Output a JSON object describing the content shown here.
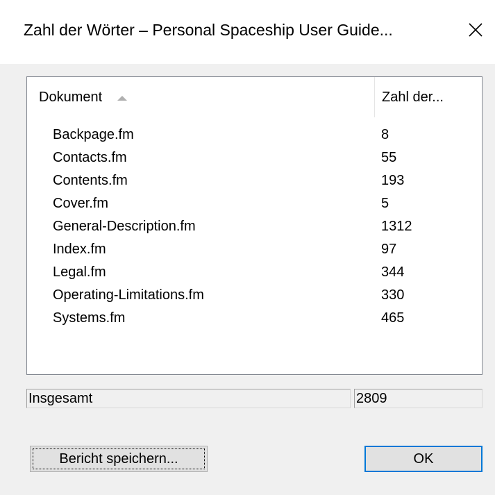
{
  "dialog": {
    "title": "Zahl der Wörter – Personal Spaceship User Guide..."
  },
  "list": {
    "columns": {
      "document": "Dokument",
      "count": "Zahl der..."
    },
    "rows": [
      {
        "name": "Backpage.fm",
        "count": "8"
      },
      {
        "name": "Contacts.fm",
        "count": "55"
      },
      {
        "name": "Contents.fm",
        "count": "193"
      },
      {
        "name": "Cover.fm",
        "count": "5"
      },
      {
        "name": "General-Description.fm",
        "count": "1312"
      },
      {
        "name": "Index.fm",
        "count": "97"
      },
      {
        "name": "Legal.fm",
        "count": "344"
      },
      {
        "name": "Operating-Limitations.fm",
        "count": "330"
      },
      {
        "name": "Systems.fm",
        "count": "465"
      }
    ]
  },
  "total": {
    "label": "Insgesamt",
    "value": "2809"
  },
  "buttons": {
    "save_report": "Bericht speichern...",
    "ok": "OK"
  },
  "icons": {
    "close": "close-icon",
    "sort": "sort-ascending-icon"
  }
}
